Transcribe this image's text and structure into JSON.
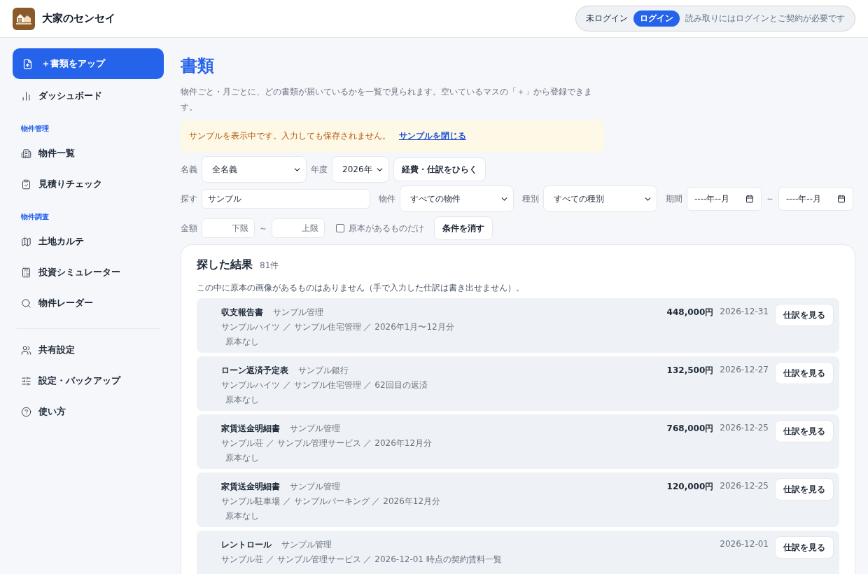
{
  "header": {
    "app_name": "大家のセンセイ",
    "login_status": "未ログイン",
    "login_button": "ログイン",
    "login_note": "読み取りにはログインとご契約が必要です"
  },
  "sidebar": {
    "upload_button": "＋書類をアップ",
    "groups": [
      {
        "items": [
          {
            "label": "ダッシュボード",
            "selected": false
          }
        ]
      },
      {
        "heading": "物件管理",
        "items": [
          {
            "label": "物件一覧",
            "selected": false
          },
          {
            "label": "見積りチェック",
            "selected": false
          }
        ]
      },
      {
        "heading": "物件調査",
        "items": [
          {
            "label": "土地カルテ",
            "selected": false
          },
          {
            "label": "投資シミュレーター",
            "selected": false
          },
          {
            "label": "物件レーダー",
            "selected": false
          }
        ]
      },
      {
        "divider": true,
        "items": [
          {
            "label": "共有設定",
            "selected": false
          },
          {
            "label": "設定・バックアップ",
            "selected": false
          },
          {
            "label": "使い方",
            "selected": false
          }
        ]
      }
    ]
  },
  "page": {
    "title": "書類",
    "description": "物件ごと・月ごとに、どの書類が届いているかを一覧で見られます。空いているマスの「＋」から登録できます。",
    "notice": "サンプルを表示中です。入力しても保存されません。",
    "notice_link": "サンプルを閉じる"
  },
  "filters": {
    "owner_label": "名義",
    "owner": "全名義",
    "year_label": "年度",
    "year": "2026年",
    "open_button": "経費・仕訳をひらく",
    "search_label": "探す",
    "search": "サンプル",
    "property_label": "物件",
    "property": "すべての物件",
    "type_label": "種別",
    "type": "すべての種別",
    "period_label": "期間",
    "period_from": "----年--月",
    "period_sep": "～",
    "period_to": "----年--月",
    "amount_label": "金額",
    "amount_min": {
      "placeholder": "下限"
    },
    "amount_sep": "～",
    "amount_max": {
      "placeholder": "上限"
    },
    "original_only": {
      "label": "原本があるものだけ",
      "checked": false
    },
    "clear_button": "条件を消す"
  },
  "results": {
    "title": "探した結果",
    "count": "81件",
    "note": "この中に原本の画像があるものはありません（手で入力した仕訳は書き出せません）。",
    "rows": [
      {
        "title": "収支報告書",
        "issuer": "サンプル管理",
        "detail": "サンプルハイツ ／ サンプル住宅管理 ／ 2026年1月〜12月分",
        "tag": "原本なし",
        "amount": "448,000円",
        "date": "2026-12-31",
        "button": "仕訳を見る"
      },
      {
        "title": "ローン返済予定表",
        "issuer": "サンプル銀行",
        "detail": "サンプルハイツ ／ サンプル住宅管理 ／ 62回目の返済",
        "tag": "原本なし",
        "amount": "132,500円",
        "date": "2026-12-27",
        "button": "仕訳を見る"
      },
      {
        "title": "家賃送金明細書",
        "issuer": "サンプル管理",
        "detail": "サンプル荘 ／ サンプル管理サービス ／ 2026年12月分",
        "tag": "原本なし",
        "amount": "768,000円",
        "date": "2026-12-25",
        "button": "仕訳を見る"
      },
      {
        "title": "家賃送金明細書",
        "issuer": "サンプル管理",
        "detail": "サンプル駐車場 ／ サンプルパーキング ／ 2026年12月分",
        "tag": "原本なし",
        "amount": "120,000円",
        "date": "2026-12-25",
        "button": "仕訳を見る"
      },
      {
        "title": "レントロール",
        "issuer": "サンプル管理",
        "detail": "サンプル荘 ／ サンプル管理サービス ／ 2026-12-01 時点の契約賃料一覧",
        "date": "2026-12-01",
        "button": "仕訳を見る"
      }
    ]
  }
}
